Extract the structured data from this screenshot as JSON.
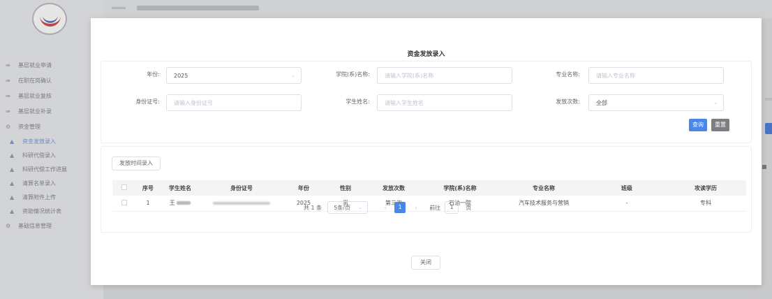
{
  "sidebar": {
    "items": [
      {
        "icon": "layers-icon",
        "label": "基层就业申请",
        "sub": false,
        "active": false
      },
      {
        "icon": "layers-icon",
        "label": "在职在岗确认",
        "sub": false,
        "active": false
      },
      {
        "icon": "layers-icon",
        "label": "基层就业复核",
        "sub": false,
        "active": false
      },
      {
        "icon": "layers-icon",
        "label": "基层就业补录",
        "sub": false,
        "active": false
      },
      {
        "icon": "gear-icon",
        "label": "资金管理",
        "sub": false,
        "active": false
      },
      {
        "icon": "folder-icon",
        "label": "资金发放录入",
        "sub": true,
        "active": true
      },
      {
        "icon": "folder-icon",
        "label": "科研代偿录入",
        "sub": true,
        "active": false
      },
      {
        "icon": "folder-icon",
        "label": "科研代偿工作进展",
        "sub": true,
        "active": false
      },
      {
        "icon": "folder-icon",
        "label": "清算名单录入",
        "sub": true,
        "active": false
      },
      {
        "icon": "folder-icon",
        "label": "清算附件上传",
        "sub": true,
        "active": false
      },
      {
        "icon": "folder-icon",
        "label": "资助情况统计表",
        "sub": true,
        "active": false
      },
      {
        "icon": "gear-icon",
        "label": "基础信息管理",
        "sub": false,
        "active": false
      }
    ]
  },
  "dialog": {
    "title": "资金发放录入",
    "filters": {
      "year_label": "年份:",
      "year_value": "2025",
      "college_label": "学院(系)名称:",
      "college_placeholder": "请输入学院(系)名称",
      "major_label": "专业名称:",
      "major_placeholder": "请输入专业名称",
      "id_label": "身份证号:",
      "id_placeholder": "请输入身份证号",
      "student_label": "学生姓名:",
      "student_placeholder": "请输入学生姓名",
      "times_label": "发放次数:",
      "times_value": "全部"
    },
    "query_button": "查询",
    "reset_button": "重置",
    "entry_button": "发放时间录入",
    "table": {
      "headers": [
        "",
        "序号",
        "学生姓名",
        "身份证号",
        "年份",
        "性别",
        "发放次数",
        "学院(系)名称",
        "专业名称",
        "班级",
        "攻读学历"
      ],
      "rows": [
        {
          "index": "1",
          "name": "王",
          "year": "2025",
          "gender": "男",
          "times": "第三次",
          "college": "石油一院",
          "major": "汽车技术服务与营销",
          "class": "-",
          "degree": "专科"
        }
      ]
    },
    "pagination": {
      "total": "共 1 条",
      "page_size": "5条/页",
      "prev": "‹",
      "current": "1",
      "next": "›",
      "goto_label": "前往",
      "goto_value": "1",
      "page_unit": "页"
    },
    "close_button": "关闭"
  },
  "colors": {
    "primary": "#4a86e8",
    "reset": "#7d7e82",
    "active_menu": "#6f89c9"
  }
}
